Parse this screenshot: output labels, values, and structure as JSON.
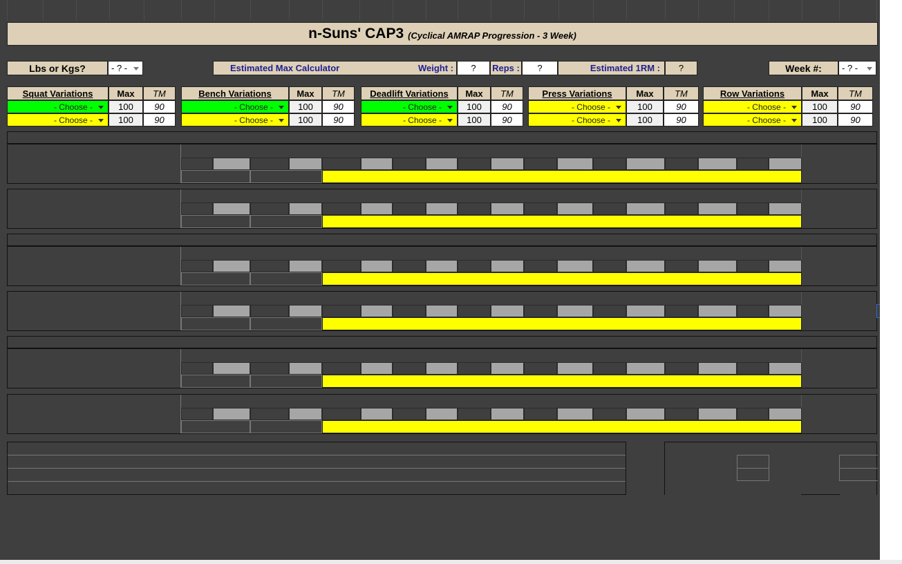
{
  "title": {
    "main": "n-Suns' CAP3",
    "sub": "(Cyclical AMRAP Progression - 3 Week)"
  },
  "units": {
    "label": "Lbs or Kgs?",
    "value": "- ? -"
  },
  "calculator": {
    "label": "Estimated Max Calculator",
    "weight_label": "Weight :",
    "weight_value": "?",
    "reps_label": "Reps :",
    "reps_value": "?",
    "rm_label": "Estimated 1RM :",
    "rm_value": "?"
  },
  "week": {
    "label": "Week #:",
    "value": "- ? -"
  },
  "lift_tables": [
    {
      "header": "Squat Variations",
      "max_label": "Max",
      "tm_label": "TM",
      "color": "#00ff00",
      "rows": [
        {
          "choice": "- Choose -",
          "max": "100",
          "tm": "90",
          "color": "#00ff00"
        },
        {
          "choice": "- Choose -",
          "max": "100",
          "tm": "90",
          "color": "#ffff00"
        }
      ]
    },
    {
      "header": "Bench Variations",
      "max_label": "Max",
      "tm_label": "TM",
      "color": "#00ff00",
      "rows": [
        {
          "choice": "- Choose -",
          "max": "100",
          "tm": "90",
          "color": "#00ff00"
        },
        {
          "choice": "- Choose -",
          "max": "100",
          "tm": "90",
          "color": "#ffff00"
        }
      ]
    },
    {
      "header": "Deadlift Variations",
      "max_label": "Max",
      "tm_label": "TM",
      "color": "#00ff00",
      "rows": [
        {
          "choice": "- Choose -",
          "max": "100",
          "tm": "90",
          "color": "#00ff00"
        },
        {
          "choice": "- Choose -",
          "max": "100",
          "tm": "90",
          "color": "#ffff00"
        }
      ]
    },
    {
      "header": "Press Variations",
      "max_label": "Max",
      "tm_label": "TM",
      "color": "#ffff00",
      "rows": [
        {
          "choice": "- Choose -",
          "max": "100",
          "tm": "90",
          "color": "#ffff00"
        },
        {
          "choice": "- Choose -",
          "max": "100",
          "tm": "90",
          "color": "#ffff00"
        }
      ]
    },
    {
      "header": "Row Variations",
      "max_label": "Max",
      "tm_label": "TM",
      "color": "#ffff00",
      "rows": [
        {
          "choice": "- Choose -",
          "max": "100",
          "tm": "90",
          "color": "#ffff00"
        },
        {
          "choice": "- Choose -",
          "max": "100",
          "tm": "90",
          "color": "#ffff00"
        }
      ]
    }
  ],
  "colors": {
    "tan": "#ddd0b6",
    "sheet_bg": "#3f3f3f",
    "set_cell": "#a6a6a6",
    "amrap_bar": "#ffff00",
    "choose_primary": "#00ff00",
    "choose_secondary": "#ffff00"
  }
}
